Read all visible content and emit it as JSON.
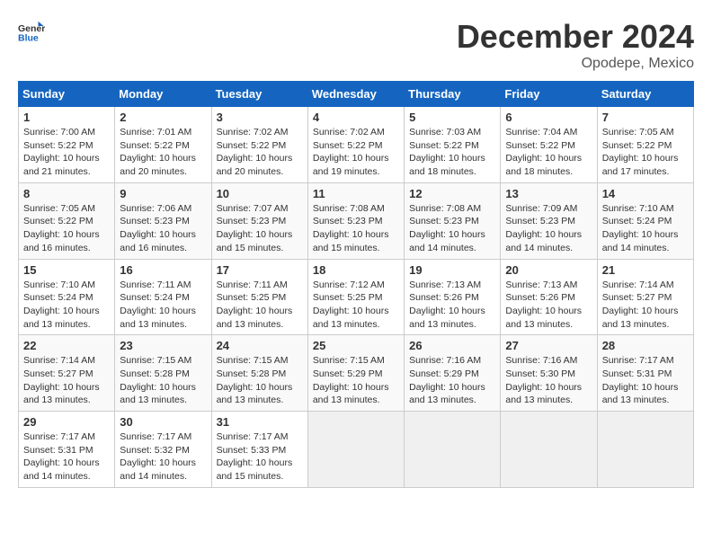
{
  "header": {
    "logo_general": "General",
    "logo_blue": "Blue",
    "title": "December 2024",
    "location": "Opodepe, Mexico"
  },
  "calendar": {
    "days_of_week": [
      "Sunday",
      "Monday",
      "Tuesday",
      "Wednesday",
      "Thursday",
      "Friday",
      "Saturday"
    ],
    "weeks": [
      [
        null,
        null,
        null,
        null,
        null,
        null,
        null
      ]
    ],
    "cells": [
      {
        "day": null
      },
      {
        "day": null
      },
      {
        "day": null
      },
      {
        "day": null
      },
      {
        "day": null
      },
      {
        "day": null
      },
      {
        "day": null
      }
    ]
  }
}
